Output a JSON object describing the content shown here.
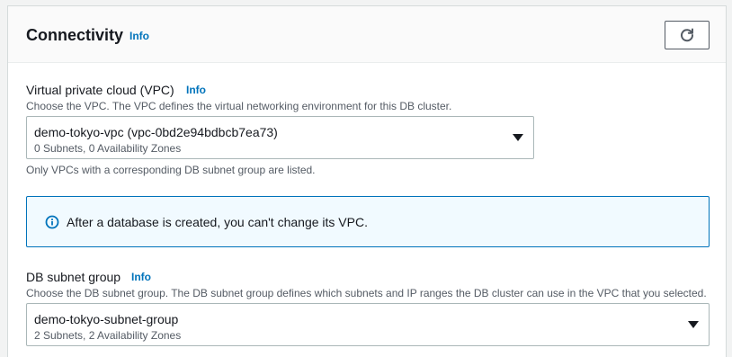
{
  "section": {
    "title": "Connectivity",
    "info_label": "Info",
    "refresh_icon": "refresh-icon"
  },
  "vpc": {
    "label": "Virtual private cloud (VPC)",
    "info_label": "Info",
    "description": "Choose the VPC. The VPC defines the virtual networking environment for this DB cluster.",
    "selected_value": "demo-tokyo-vpc (vpc-0bd2e94bdbcb7ea73)",
    "selected_detail": "0 Subnets, 0 Availability Zones",
    "constraint": "Only VPCs with a corresponding DB subnet group are listed."
  },
  "alert": {
    "icon": "info-circle-icon",
    "text": "After a database is created, you can't change its VPC."
  },
  "subnet_group": {
    "label": "DB subnet group",
    "info_label": "Info",
    "description": "Choose the DB subnet group. The DB subnet group defines which subnets and IP ranges the DB cluster can use in the VPC that you selected.",
    "selected_value": "demo-tokyo-subnet-group",
    "selected_detail": "2 Subnets, 2 Availability Zones"
  },
  "colors": {
    "link": "#0073bb",
    "alert_background": "#f1faff",
    "alert_border": "#0073bb",
    "text": "#16191f",
    "secondary_text": "#545b64"
  }
}
